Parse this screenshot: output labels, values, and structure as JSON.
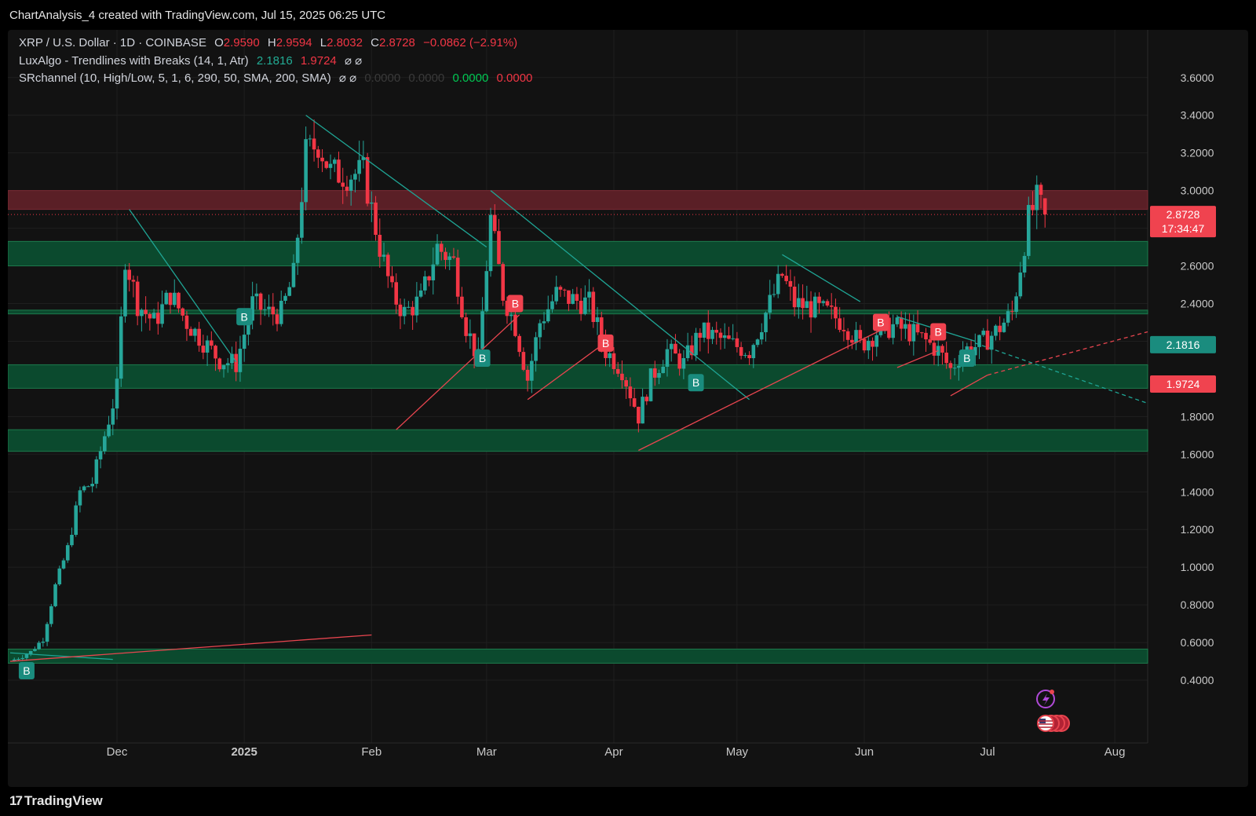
{
  "header": {
    "title": "ChartAnalysis_4 created with TradingView.com, Jul 15, 2025 06:25 UTC"
  },
  "legend": {
    "symbol": "XRP / U.S. Dollar · 1D · COINBASE",
    "o_label": "O",
    "o": "2.9590",
    "h_label": "H",
    "h": "2.9594",
    "l_label": "L",
    "l": "2.8032",
    "c_label": "C",
    "c": "2.8728",
    "change": "−0.0862 (−2.91%)",
    "ind1_name": "LuxAlgo - Trendlines with Breaks (14, 1, Atr)",
    "ind1_v1": "2.1816",
    "ind1_v2": "1.9724",
    "ind1_icons": "⌀ ⌀",
    "ind2_name": "SRchannel (10, High/Low, 5, 1, 6, 290, 50, SMA, 200, SMA)",
    "ind2_icons": "⌀ ⌀",
    "ind2_dim1": "0.0000",
    "ind2_dim2": "0.0000",
    "ind2_v1": "0.0000",
    "ind2_v2": "0.0000"
  },
  "footer": {
    "brand": "TradingView",
    "brand_mark": "17"
  },
  "price_tags": {
    "last_price": "2.8728",
    "countdown": "17:34:47",
    "upper_trend": "2.1816",
    "lower_trend": "1.9724"
  },
  "colors": {
    "up": "#26a69a",
    "down": "#f23645",
    "background": "#121212",
    "resistance_zone": "#5a1f26",
    "support_zone": "#0b4a2e",
    "grid": "#1f1f1f"
  },
  "chart_data": {
    "type": "candlestick",
    "title": "XRP / U.S. Dollar · 1D · COINBASE",
    "ylim": [
      0.3,
      3.72
    ],
    "y_ticks": [
      0.4,
      0.6,
      0.8,
      1.0,
      1.2,
      1.4,
      1.6,
      1.8,
      2.0,
      2.2,
      2.4,
      2.6,
      2.8,
      3.0,
      3.2,
      3.4,
      3.6
    ],
    "x_ticks": [
      {
        "label": "Dec",
        "date": "2024-12-01"
      },
      {
        "label": "2025",
        "date": "2025-01-01",
        "bold": true
      },
      {
        "label": "Feb",
        "date": "2025-02-01"
      },
      {
        "label": "Mar",
        "date": "2025-03-01"
      },
      {
        "label": "Apr",
        "date": "2025-04-01"
      },
      {
        "label": "May",
        "date": "2025-05-01"
      },
      {
        "label": "Jun",
        "date": "2025-06-01"
      },
      {
        "label": "Jul",
        "date": "2025-07-01"
      },
      {
        "label": "Aug",
        "date": "2025-08-01"
      }
    ],
    "x_range": [
      "2024-11-05",
      "2025-08-09"
    ],
    "grid": true,
    "last": {
      "open": 2.959,
      "high": 2.9594,
      "low": 2.8032,
      "close": 2.8728
    },
    "price_path": [
      [
        "2024-11-05",
        0.5
      ],
      [
        "2024-11-10",
        0.55
      ],
      [
        "2024-11-13",
        0.62
      ],
      [
        "2024-11-16",
        0.9
      ],
      [
        "2024-11-19",
        1.1
      ],
      [
        "2024-11-22",
        1.4
      ],
      [
        "2024-11-25",
        1.45
      ],
      [
        "2024-11-28",
        1.7
      ],
      [
        "2024-12-01",
        1.95
      ],
      [
        "2024-12-03",
        2.65
      ],
      [
        "2024-12-06",
        2.4
      ],
      [
        "2024-12-10",
        2.3
      ],
      [
        "2024-12-14",
        2.45
      ],
      [
        "2024-12-18",
        2.3
      ],
      [
        "2024-12-22",
        2.2
      ],
      [
        "2024-12-26",
        2.1
      ],
      [
        "2024-12-30",
        2.08
      ],
      [
        "2025-01-03",
        2.4
      ],
      [
        "2025-01-07",
        2.35
      ],
      [
        "2025-01-10",
        2.35
      ],
      [
        "2025-01-13",
        2.55
      ],
      [
        "2025-01-16",
        3.2
      ],
      [
        "2025-01-19",
        3.25
      ],
      [
        "2025-01-22",
        3.1
      ],
      [
        "2025-01-26",
        3.08
      ],
      [
        "2025-01-30",
        3.1
      ],
      [
        "2025-02-03",
        2.7
      ],
      [
        "2025-02-06",
        2.45
      ],
      [
        "2025-02-09",
        2.35
      ],
      [
        "2025-02-13",
        2.42
      ],
      [
        "2025-02-17",
        2.7
      ],
      [
        "2025-02-21",
        2.62
      ],
      [
        "2025-02-24",
        2.28
      ],
      [
        "2025-02-27",
        2.1
      ],
      [
        "2025-03-02",
        2.85
      ],
      [
        "2025-03-05",
        2.45
      ],
      [
        "2025-03-08",
        2.28
      ],
      [
        "2025-03-11",
        2.0
      ],
      [
        "2025-03-14",
        2.3
      ],
      [
        "2025-03-18",
        2.45
      ],
      [
        "2025-03-22",
        2.42
      ],
      [
        "2025-03-26",
        2.4
      ],
      [
        "2025-03-30",
        2.15
      ],
      [
        "2025-04-03",
        2.05
      ],
      [
        "2025-04-07",
        1.8
      ],
      [
        "2025-04-10",
        2.0
      ],
      [
        "2025-04-14",
        2.15
      ],
      [
        "2025-04-18",
        2.08
      ],
      [
        "2025-04-22",
        2.25
      ],
      [
        "2025-04-26",
        2.22
      ],
      [
        "2025-04-30",
        2.18
      ],
      [
        "2025-05-04",
        2.15
      ],
      [
        "2025-05-08",
        2.35
      ],
      [
        "2025-05-12",
        2.55
      ],
      [
        "2025-05-15",
        2.4
      ],
      [
        "2025-05-19",
        2.38
      ],
      [
        "2025-05-23",
        2.35
      ],
      [
        "2025-05-27",
        2.3
      ],
      [
        "2025-05-31",
        2.18
      ],
      [
        "2025-06-04",
        2.25
      ],
      [
        "2025-06-08",
        2.28
      ],
      [
        "2025-06-12",
        2.25
      ],
      [
        "2025-06-16",
        2.2
      ],
      [
        "2025-06-19",
        2.15
      ],
      [
        "2025-06-22",
        2.05
      ],
      [
        "2025-06-25",
        2.15
      ],
      [
        "2025-06-29",
        2.18
      ],
      [
        "2025-07-03",
        2.25
      ],
      [
        "2025-07-07",
        2.35
      ],
      [
        "2025-07-09",
        2.6
      ],
      [
        "2025-07-11",
        2.85
      ],
      [
        "2025-07-13",
        2.95
      ],
      [
        "2025-07-15",
        2.87
      ]
    ],
    "zones": [
      {
        "kind": "resistance",
        "from": 2.9,
        "to": 3.0
      },
      {
        "kind": "support",
        "from": 2.6,
        "to": 2.73
      },
      {
        "kind": "support",
        "from": 2.345,
        "to": 2.365
      },
      {
        "kind": "support",
        "from": 1.95,
        "to": 2.075
      },
      {
        "kind": "support",
        "from": 1.615,
        "to": 1.73
      },
      {
        "kind": "support",
        "from": 0.49,
        "to": 0.565
      }
    ],
    "trendlines": [
      {
        "color": "down_trend",
        "from": [
          "2024-12-04",
          2.9
        ],
        "to": [
          "2024-12-30",
          2.09
        ]
      },
      {
        "color": "down_trend",
        "from": [
          "2025-01-16",
          3.4
        ],
        "to": [
          "2025-03-01",
          2.7
        ]
      },
      {
        "color": "down_trend",
        "from": [
          "2025-03-02",
          3.0
        ],
        "to": [
          "2025-05-04",
          1.89
        ]
      },
      {
        "color": "down_trend",
        "from": [
          "2025-05-12",
          2.66
        ],
        "to": [
          "2025-05-31",
          2.41
        ]
      },
      {
        "color": "down_trend",
        "from": [
          "2025-06-09",
          2.33
        ],
        "to": [
          "2025-06-28",
          2.2
        ]
      },
      {
        "color": "down_trend",
        "from": [
          "2024-11-05",
          0.545
        ],
        "to": [
          "2024-11-30",
          0.51
        ]
      },
      {
        "color": "up_trend",
        "from": [
          "2025-02-07",
          1.73
        ],
        "to": [
          "2025-03-09",
          2.34
        ]
      },
      {
        "color": "up_trend",
        "from": [
          "2025-03-11",
          1.89
        ],
        "to": [
          "2025-03-31",
          2.21
        ]
      },
      {
        "color": "up_trend",
        "from": [
          "2025-04-07",
          1.62
        ],
        "to": [
          "2025-06-07",
          2.28
        ]
      },
      {
        "color": "up_trend",
        "from": [
          "2025-06-09",
          2.06
        ],
        "to": [
          "2025-06-19",
          2.15
        ]
      },
      {
        "color": "up_trend",
        "from": [
          "2025-06-22",
          1.91
        ],
        "to": [
          "2025-07-01",
          2.02
        ]
      },
      {
        "color": "up_trend",
        "from": [
          "2024-11-05",
          0.5
        ],
        "to": [
          "2025-02-01",
          0.64
        ]
      }
    ],
    "projections": [
      {
        "color": "up_trend",
        "dashed": true,
        "from": [
          "2025-07-01",
          2.02
        ],
        "to": [
          "2025-08-09",
          2.25
        ]
      },
      {
        "color": "down_trend",
        "dashed": true,
        "from": [
          "2025-06-28",
          2.19
        ],
        "to": [
          "2025-08-09",
          1.87
        ]
      }
    ],
    "break_labels": [
      {
        "date": "2024-11-09",
        "price": 0.45,
        "text": "B",
        "kind": "up"
      },
      {
        "date": "2025-01-01",
        "price": 2.33,
        "text": "B",
        "kind": "up"
      },
      {
        "date": "2025-02-28",
        "price": 2.11,
        "text": "B",
        "kind": "up"
      },
      {
        "date": "2025-03-08",
        "price": 2.4,
        "text": "B",
        "kind": "down"
      },
      {
        "date": "2025-03-30",
        "price": 2.19,
        "text": "B",
        "kind": "down"
      },
      {
        "date": "2025-04-21",
        "price": 1.98,
        "text": "B",
        "kind": "up"
      },
      {
        "date": "2025-06-05",
        "price": 2.3,
        "text": "B",
        "kind": "down"
      },
      {
        "date": "2025-06-19",
        "price": 2.25,
        "text": "B",
        "kind": "down"
      },
      {
        "date": "2025-06-26",
        "price": 2.11,
        "text": "B",
        "kind": "up"
      }
    ]
  }
}
